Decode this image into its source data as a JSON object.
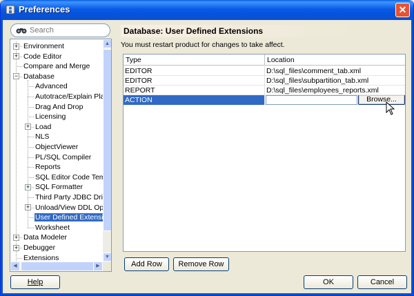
{
  "window": {
    "title": "Preferences",
    "close_label": "✕"
  },
  "search": {
    "placeholder": "Search"
  },
  "tree": {
    "items": [
      {
        "label": "Environment",
        "level": 0,
        "expander": "+"
      },
      {
        "label": "Code Editor",
        "level": 0,
        "expander": "+"
      },
      {
        "label": "Compare and Merge",
        "level": 0,
        "expander": ""
      },
      {
        "label": "Database",
        "level": 0,
        "expander": "−"
      },
      {
        "label": "Advanced",
        "level": 1,
        "expander": ""
      },
      {
        "label": "Autotrace/Explain Plan",
        "level": 1,
        "expander": ""
      },
      {
        "label": "Drag And Drop",
        "level": 1,
        "expander": ""
      },
      {
        "label": "Licensing",
        "level": 1,
        "expander": ""
      },
      {
        "label": "Load",
        "level": 1,
        "expander": "+"
      },
      {
        "label": "NLS",
        "level": 1,
        "expander": ""
      },
      {
        "label": "ObjectViewer",
        "level": 1,
        "expander": ""
      },
      {
        "label": "PL/SQL Compiler",
        "level": 1,
        "expander": ""
      },
      {
        "label": "Reports",
        "level": 1,
        "expander": ""
      },
      {
        "label": "SQL Editor Code Templa",
        "level": 1,
        "expander": ""
      },
      {
        "label": "SQL Formatter",
        "level": 1,
        "expander": "+"
      },
      {
        "label": "Third Party JDBC Driver",
        "level": 1,
        "expander": ""
      },
      {
        "label": "Unload/View DDL Option",
        "level": 1,
        "expander": "+"
      },
      {
        "label": "User Defined Extension",
        "level": 1,
        "expander": "",
        "selected": true
      },
      {
        "label": "Worksheet",
        "level": 1,
        "expander": ""
      },
      {
        "label": "Data Modeler",
        "level": 0,
        "expander": "+"
      },
      {
        "label": "Debugger",
        "level": 0,
        "expander": "+"
      },
      {
        "label": "Extensions",
        "level": 0,
        "expander": ""
      }
    ]
  },
  "page": {
    "title": "Database: User Defined Extensions",
    "restart_message": "You must restart product for changes to take affect."
  },
  "table": {
    "headers": [
      "Type",
      "Location"
    ],
    "rows": [
      {
        "type": "EDITOR",
        "location": "D:\\sql_files\\comment_tab.xml"
      },
      {
        "type": "EDITOR",
        "location": "D:\\sql_files\\subpartition_tab.xml"
      },
      {
        "type": "REPORT",
        "location": "D:\\sql_files\\employees_reports.xml"
      },
      {
        "type": "ACTION",
        "location": ""
      }
    ],
    "browse_label": "Browse..."
  },
  "buttons": {
    "add_row": "Add Row",
    "remove_row": "Remove Row",
    "help": "Help",
    "ok": "OK",
    "cancel": "Cancel"
  },
  "colors": {
    "title_bar": "#0a5ae6",
    "selection": "#316ac5",
    "dialog_bg": "#ece9d8"
  }
}
